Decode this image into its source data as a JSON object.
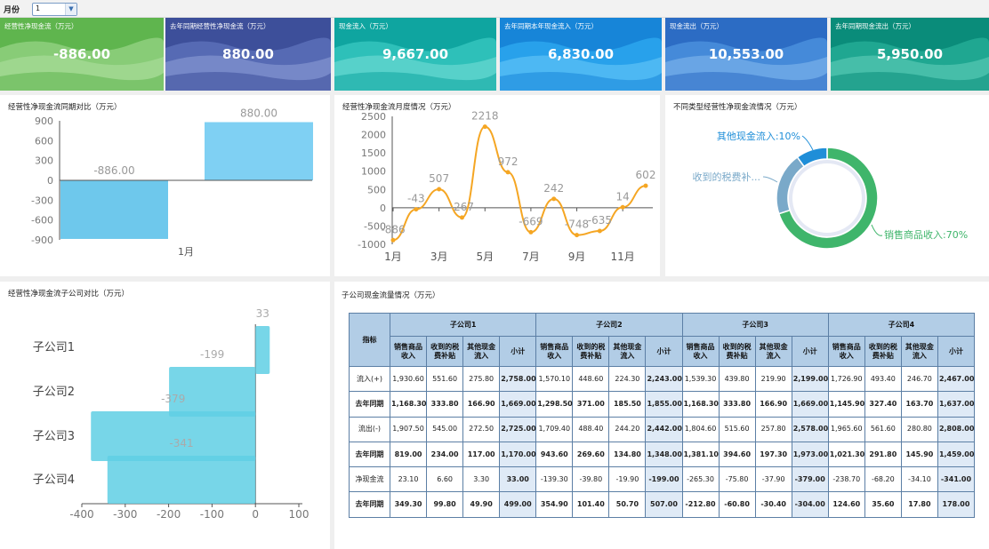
{
  "filter": {
    "label": "月份",
    "value": "1"
  },
  "kpis": [
    {
      "title": "经营性净现金流（万元）",
      "value": "-886.00",
      "c1": "#5fb54e",
      "c2": "#8fd07f",
      "c3": "#a8dc98"
    },
    {
      "title": "去年同期经营性净现金流（万元）",
      "value": "880.00",
      "c1": "#3d4f9a",
      "c2": "#5a6fb8",
      "c3": "#8596d0"
    },
    {
      "title": "现金流入（万元）",
      "value": "9,667.00",
      "c1": "#0fa5a0",
      "c2": "#34c4bd",
      "c3": "#6ad9d2"
    },
    {
      "title": "去年同期本年现金流入（万元）",
      "value": "6,830.00",
      "c1": "#1785d8",
      "c2": "#2ba6ef",
      "c3": "#5cc2f6"
    },
    {
      "title": "现金流出（万元）",
      "value": "10,553.00",
      "c1": "#2c6cc4",
      "c2": "#4a8fdd",
      "c3": "#79b0ea"
    },
    {
      "title": "去年同期现金流出（万元）",
      "value": "5,950.00",
      "c1": "#0a8c7a",
      "c2": "#23ab95",
      "c3": "#57c8b3"
    }
  ],
  "panels": {
    "yoy_title": "经营性净现金流同期对比（万元）",
    "monthly_title": "经营性净现金流月度情况（万元）",
    "types_title": "不同类型经营性净现金流情况（万元）",
    "subsidiary_title": "经营性净现金流子公司对比（万元）",
    "table_title": "子公司现金流量情况（万元）"
  },
  "chart_data": [
    {
      "type": "bar",
      "title": "经营性净现金流同期对比（万元）",
      "categories": [
        "1月"
      ],
      "series": [
        {
          "values": [
            -886.0
          ],
          "label": "-886.00",
          "color": "#6ec8ec"
        },
        {
          "values": [
            880.0
          ],
          "label": "880.00",
          "color": "#7fd0f3"
        }
      ],
      "yticks": [
        "900",
        "600",
        "300",
        "0",
        "-300",
        "-600",
        "-900"
      ],
      "ylim": [
        -900,
        900
      ]
    },
    {
      "type": "line",
      "title": "经营性净现金流月度情况（万元）",
      "x": [
        "1月",
        "2月",
        "3月",
        "4月",
        "5月",
        "6月",
        "7月",
        "8月",
        "9月",
        "10月",
        "11月",
        "12月"
      ],
      "xticks": [
        "1月",
        "3月",
        "5月",
        "7月",
        "9月",
        "11月"
      ],
      "values": [
        -886,
        -43,
        507,
        -267,
        2218,
        972,
        -669,
        242,
        -748,
        -635,
        14,
        602
      ],
      "labels": [
        "-886",
        "-43",
        "507",
        "-267",
        "2218",
        "972",
        "-669",
        "242",
        "-748",
        "-635",
        "14",
        "602"
      ],
      "yticks": [
        "2500",
        "2000",
        "1500",
        "1000",
        "500",
        "0",
        "-500",
        "-1000"
      ],
      "ylim": [
        -1000,
        2500
      ],
      "color": "#f5a623"
    },
    {
      "type": "pie",
      "title": "不同类型经营性净现金流情况（万元）",
      "slices": [
        {
          "name": "销售商品收入",
          "value": 70,
          "label": "销售商品收入:70%",
          "color": "#3fb56b"
        },
        {
          "name": "收到的税费补贴",
          "value": 20,
          "label": "收到的税费补...",
          "color": "#7aa9c9"
        },
        {
          "name": "其他现金流入",
          "value": 10,
          "label": "其他现金流入:10%",
          "color": "#1f8ed8"
        }
      ]
    },
    {
      "type": "bar",
      "title": "经营性净现金流子公司对比（万元）",
      "orientation": "horizontal",
      "categories": [
        "子公司1",
        "子公司2",
        "子公司3",
        "子公司4"
      ],
      "values": [
        33,
        -199,
        -379,
        -341
      ],
      "labels": [
        "33",
        "-199",
        "-379",
        "-341"
      ],
      "xticks": [
        "-400",
        "-300",
        "-200",
        "-100",
        "0",
        "100"
      ],
      "xlim": [
        -400,
        100
      ],
      "color": "#5fcfe4"
    }
  ],
  "table": {
    "corner": "指标",
    "groups": [
      "子公司1",
      "子公司2",
      "子公司3",
      "子公司4"
    ],
    "subcols": [
      "销售商品收入",
      "收到的税费补贴",
      "其他现金流入",
      "小计"
    ],
    "rows": [
      {
        "label": "流入(+)",
        "bold": false,
        "cells": [
          "1,930.60",
          "551.60",
          "275.80",
          "2,758.00",
          "1,570.10",
          "448.60",
          "224.30",
          "2,243.00",
          "1,539.30",
          "439.80",
          "219.90",
          "2,199.00",
          "1,726.90",
          "493.40",
          "246.70",
          "2,467.00"
        ]
      },
      {
        "label": "去年同期",
        "bold": true,
        "cells": [
          "1,168.30",
          "333.80",
          "166.90",
          "1,669.00",
          "1,298.50",
          "371.00",
          "185.50",
          "1,855.00",
          "1,168.30",
          "333.80",
          "166.90",
          "1,669.00",
          "1,145.90",
          "327.40",
          "163.70",
          "1,637.00"
        ]
      },
      {
        "label": "流出(-)",
        "bold": false,
        "cells": [
          "1,907.50",
          "545.00",
          "272.50",
          "2,725.00",
          "1,709.40",
          "488.40",
          "244.20",
          "2,442.00",
          "1,804.60",
          "515.60",
          "257.80",
          "2,578.00",
          "1,965.60",
          "561.60",
          "280.80",
          "2,808.00"
        ]
      },
      {
        "label": "去年同期",
        "bold": true,
        "cells": [
          "819.00",
          "234.00",
          "117.00",
          "1,170.00",
          "943.60",
          "269.60",
          "134.80",
          "1,348.00",
          "1,381.10",
          "394.60",
          "197.30",
          "1,973.00",
          "1,021.30",
          "291.80",
          "145.90",
          "1,459.00"
        ]
      },
      {
        "label": "净现金流",
        "bold": false,
        "cells": [
          "23.10",
          "6.60",
          "3.30",
          "33.00",
          "-139.30",
          "-39.80",
          "-19.90",
          "-199.00",
          "-265.30",
          "-75.80",
          "-37.90",
          "-379.00",
          "-238.70",
          "-68.20",
          "-34.10",
          "-341.00"
        ]
      },
      {
        "label": "去年同期",
        "bold": true,
        "cells": [
          "349.30",
          "99.80",
          "49.90",
          "499.00",
          "354.90",
          "101.40",
          "50.70",
          "507.00",
          "-212.80",
          "-60.80",
          "-30.40",
          "-304.00",
          "124.60",
          "35.60",
          "17.80",
          "178.00"
        ]
      }
    ]
  }
}
